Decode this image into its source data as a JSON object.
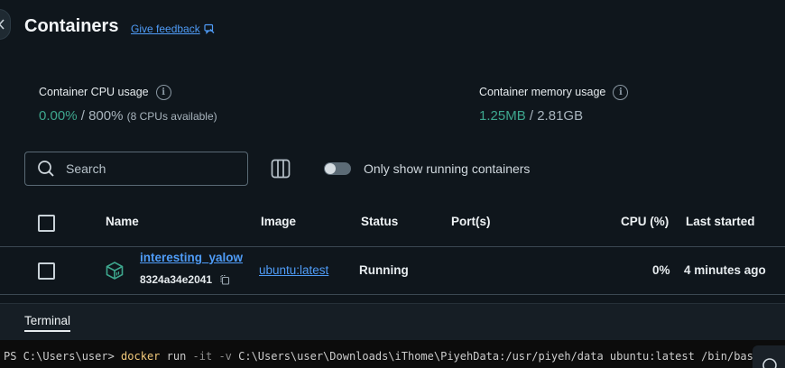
{
  "page": {
    "title": "Containers",
    "feedback_label": "Give feedback"
  },
  "stats": {
    "cpu": {
      "label": "Container CPU usage",
      "used": "0.00%",
      "separator": " / ",
      "total": "800%",
      "note": "(8 CPUs available)"
    },
    "memory": {
      "label": "Container memory usage",
      "used": "1.25MB",
      "separator": " / ",
      "total": "2.81GB"
    }
  },
  "toolbar": {
    "search_placeholder": "Search",
    "toggle_label": "Only show running containers",
    "toggle_on": false
  },
  "table": {
    "columns": [
      "Name",
      "Image",
      "Status",
      "Port(s)",
      "CPU (%)",
      "Last started"
    ],
    "rows": [
      {
        "name": "interesting_yalow",
        "id": "8324a34e2041",
        "image": "ubuntu:latest",
        "status": "Running",
        "ports": "",
        "cpu": "0%",
        "last_started": "4 minutes ago"
      }
    ]
  },
  "terminal": {
    "tab_label": "Terminal",
    "prompt": "PS C:\\Users\\user> ",
    "command": "docker",
    "arg1": " run ",
    "flag1": "-it",
    "mid1": " ",
    "flag2": "-v",
    "rest": " C:\\Users\\user\\Downloads\\iThome\\PiyehData:/usr/piyeh/data ubuntu:latest /bin/bash"
  },
  "colors": {
    "background": "#0f161c",
    "accent_link": "#4f9cf7",
    "usage_green": "#3ea78e"
  },
  "icons": {
    "back": "chevron-left-icon",
    "feedback": "feedback-icon",
    "info": "info-icon",
    "search": "search-icon",
    "columns": "columns-icon",
    "container": "container-cube-icon",
    "copy": "copy-icon"
  }
}
